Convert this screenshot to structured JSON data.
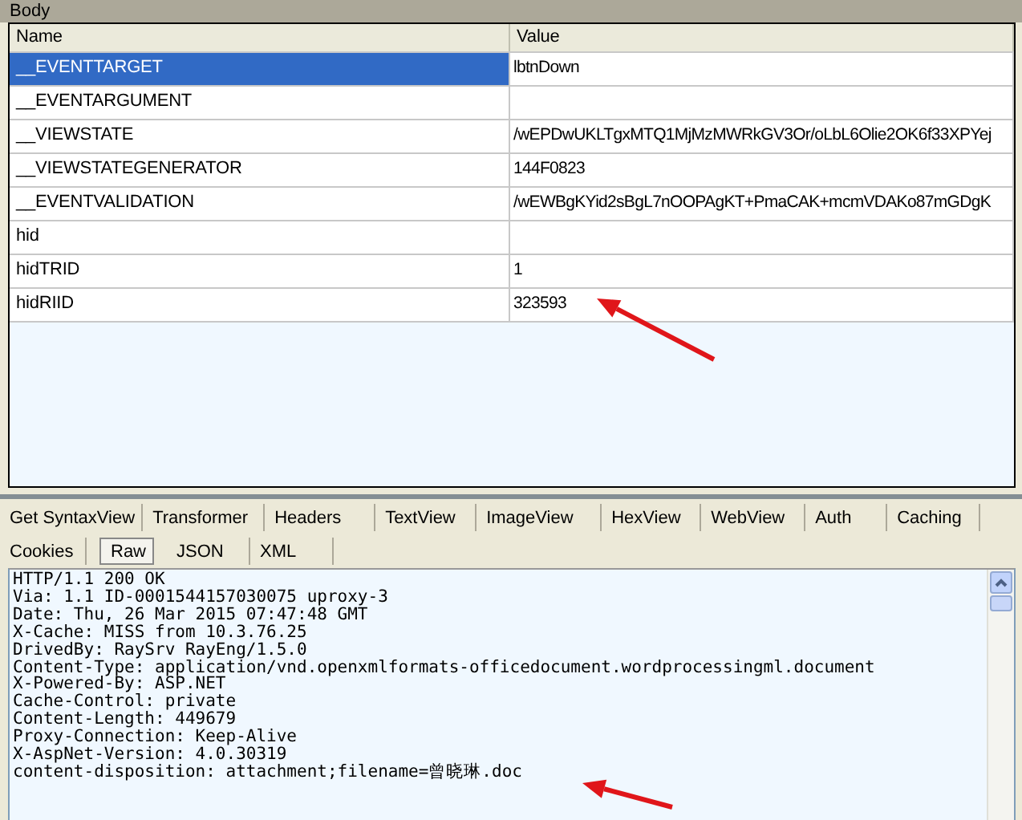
{
  "body_panel": {
    "title": "Body",
    "columns": [
      "Name",
      "Value"
    ],
    "rows": [
      {
        "name": "__EVENTTARGET",
        "value": "lbtnDown",
        "selected": true
      },
      {
        "name": "__EVENTARGUMENT",
        "value": "",
        "selected": false
      },
      {
        "name": "__VIEWSTATE",
        "value": "/wEPDwUKLTgxMTQ1MjMzMWRkGV3Or/oLbL6Olie2OK6f33XPYej",
        "selected": false
      },
      {
        "name": "__VIEWSTATEGENERATOR",
        "value": "144F0823",
        "selected": false
      },
      {
        "name": "__EVENTVALIDATION",
        "value": "/wEWBgKYid2sBgL7nOOPAgKT+PmaCAK+mcmVDAKo87mGDgK",
        "selected": false
      },
      {
        "name": "hid",
        "value": "",
        "selected": false
      },
      {
        "name": "hidTRID",
        "value": "1",
        "selected": false
      },
      {
        "name": "hidRIID",
        "value": "323593",
        "selected": false
      }
    ]
  },
  "response_tabs": [
    [
      {
        "label": "Get SyntaxView",
        "selected": false
      },
      {
        "label": "Transformer",
        "selected": false
      },
      {
        "label": "Headers",
        "selected": false
      },
      {
        "label": "TextView",
        "selected": false
      },
      {
        "label": "ImageView",
        "selected": false
      },
      {
        "label": "HexView",
        "selected": false
      },
      {
        "label": "WebView",
        "selected": false
      },
      {
        "label": "Auth",
        "selected": false
      },
      {
        "label": "Caching",
        "selected": false
      }
    ],
    [
      {
        "label": "Cookies",
        "selected": false
      },
      {
        "label": "Raw",
        "selected": true
      },
      {
        "label": "JSON",
        "selected": false
      },
      {
        "label": "XML",
        "selected": false
      }
    ]
  ],
  "raw_lines": [
    "HTTP/1.1 200 OK",
    "Via: 1.1 ID-0001544157030075 uproxy-3",
    "Date: Thu, 26 Mar 2015 07:47:48 GMT",
    "X-Cache: MISS from 10.3.76.25",
    "DrivedBy: RaySrv RayEng/1.5.0",
    "Content-Type: application/vnd.openxmlformats-officedocument.wordprocessingml.document",
    "X-Powered-By: ASP.NET",
    "Cache-Control: private",
    "Content-Length: 449679",
    "Proxy-Connection: Keep-Alive",
    "X-AspNet-Version: 4.0.30319",
    "content-disposition: attachment;filename=曾晓琳.doc"
  ]
}
